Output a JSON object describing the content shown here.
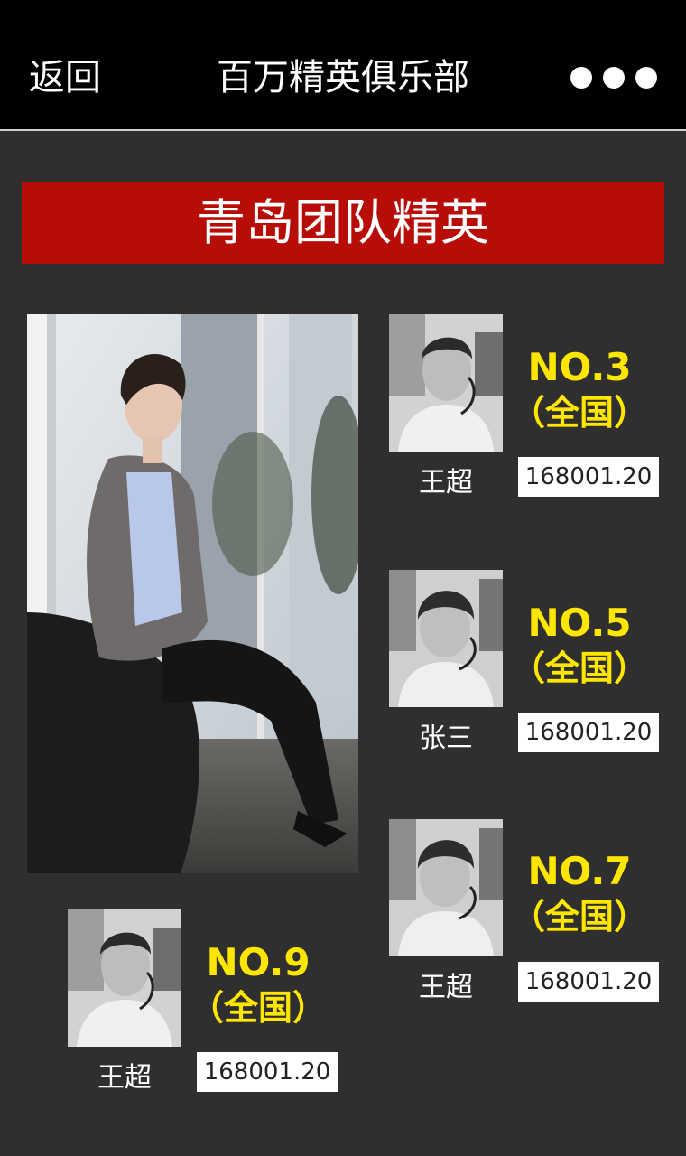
{
  "header": {
    "back_label": "返回",
    "title": "百万精英俱乐部",
    "more_icon": "more-dots-icon"
  },
  "banner": {
    "title": "青岛团队精英"
  },
  "colors": {
    "banner_red": "#b80d07",
    "rank_yellow": "#ffe600",
    "background": "#2f2f2f"
  },
  "members": [
    {
      "name": "王超",
      "rank": "NO.3",
      "scope": "（全国）",
      "score": "168001.20"
    },
    {
      "name": "张三",
      "rank": "NO.5",
      "scope": "（全国）",
      "score": "168001.20"
    },
    {
      "name": "王超",
      "rank": "NO.7",
      "scope": "（全国）",
      "score": "168001.20"
    },
    {
      "name": "王超",
      "rank": "NO.9",
      "scope": "（全国）",
      "score": "168001.20"
    }
  ]
}
